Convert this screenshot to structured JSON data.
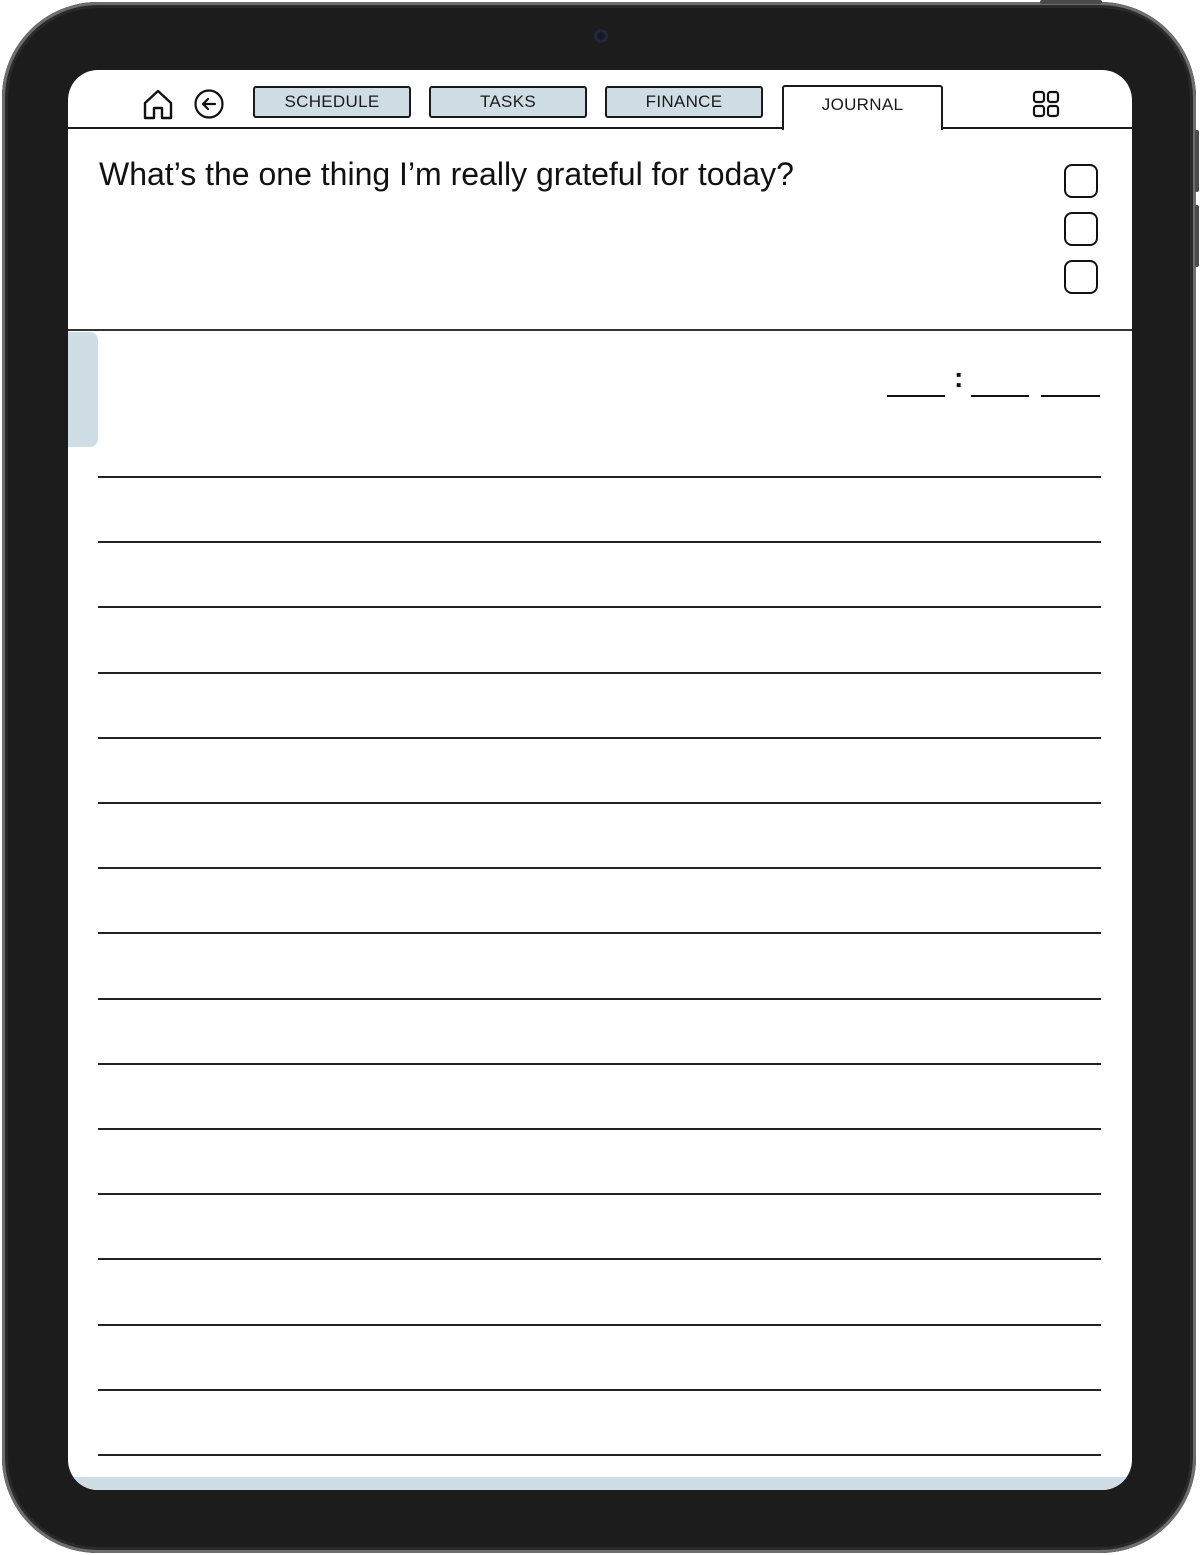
{
  "nav": {
    "icons": {
      "home": "home-icon",
      "back": "back-arrow-icon",
      "grid": "grid-icon"
    },
    "tabs": [
      {
        "label": "SCHEDULE",
        "active": false
      },
      {
        "label": "TASKS",
        "active": false
      },
      {
        "label": "FINANCE",
        "active": false
      },
      {
        "label": "JOURNAL",
        "active": true
      }
    ]
  },
  "prompt": {
    "question": "What’s the one thing I’m really grateful for today?"
  },
  "time_field": {
    "separator": ":"
  },
  "colors": {
    "accent": "#cfdde5",
    "ink": "#1a1a1a",
    "bezel": "#1c1c1c"
  }
}
